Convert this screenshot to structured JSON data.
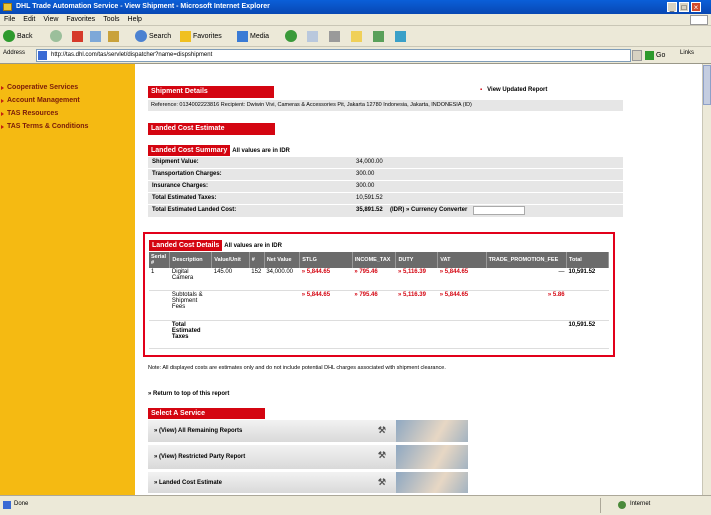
{
  "window": {
    "title": "DHL Trade Automation Service - View Shipment - Microsoft Internet Explorer",
    "min": "_",
    "max": "□",
    "close": "×"
  },
  "menu": [
    "File",
    "Edit",
    "View",
    "Favorites",
    "Tools",
    "Help"
  ],
  "toolbar": {
    "back": "Back",
    "search": "Search",
    "favorites": "Favorites",
    "media": "Media"
  },
  "address": {
    "label": "Address",
    "url": "http://tas.dhl.com/tas/servlet/dispatcher?name=dispshipment",
    "go": "Go",
    "links": "Links"
  },
  "sidebar": {
    "items": [
      {
        "label": "Cooperative Services"
      },
      {
        "label": "Account Management"
      },
      {
        "label": "TAS Resources"
      },
      {
        "label": "TAS Terms & Conditions"
      }
    ]
  },
  "shipment": {
    "header": "Shipment Details",
    "view_report": "View Updated Report",
    "reference_line": "Reference: 0134002223816  Recipient: Dwiwin Vivi, Cameras & Accessories Pit, Jakarta 12780 Indonesia, Jakarta, INDONESIA (ID)"
  },
  "landed_estimate": {
    "header": "Landed Cost Estimate"
  },
  "summary": {
    "header": "Landed Cost Summary",
    "note": "All values are in IDR",
    "rows": [
      {
        "label": "Shipment Value:",
        "value": "34,000.00"
      },
      {
        "label": "Transportation Charges:",
        "value": "300.00"
      },
      {
        "label": "Insurance Charges:",
        "value": "300.00"
      },
      {
        "label": "Total Estimated Taxes:",
        "value": "10,591.52"
      },
      {
        "label": "Total Estimated Landed Cost:",
        "value": "35,891.52",
        "extra": "(IDR) » Currency Converter"
      }
    ]
  },
  "details": {
    "header": "Landed Cost Details",
    "note": "All values are in IDR",
    "columns": [
      "Serial #",
      "Description",
      "Value/Unit",
      "#",
      "Net Value",
      "STLG",
      "INCOME_TAX",
      "DUTY",
      "VAT",
      "TRADE_PROMOTION_FEE",
      "Total"
    ],
    "rows": [
      {
        "cells": [
          "1",
          "Digital Camera",
          "145.00",
          "152",
          "34,000.00",
          "» 5,844.65",
          "» 795.46",
          "» 5,116.39",
          "» 5,844.65",
          "—",
          "10,591.52"
        ]
      },
      {
        "cells": [
          "",
          "Subtotals & Shipment Fees",
          "",
          "",
          "",
          "» 5,844.65",
          "» 795.46",
          "» 5,116.39",
          "» 5,844.65",
          "» 5.86",
          ""
        ]
      },
      {
        "cells": [
          "",
          "Total Estimated Taxes",
          "",
          "",
          "",
          "",
          "",
          "",
          "",
          "",
          "10,591.52"
        ]
      }
    ]
  },
  "note": "Note: All displayed costs are estimates only and do not include potential DHL charges associated with shipment clearance.",
  "return_link": "» Return to top of this report",
  "services": {
    "header": "Select A Service",
    "items": [
      {
        "label": "» (View) All Remaining Reports"
      },
      {
        "label": "» (View) Restricted Party Report"
      },
      {
        "label": "» Landed Cost Estimate"
      }
    ]
  },
  "status": {
    "left": "Done",
    "zone": "Internet"
  },
  "colors": {
    "dhl_red": "#d40511",
    "dhl_yellow": "#f5ba12",
    "highlight": "#e2001a"
  }
}
